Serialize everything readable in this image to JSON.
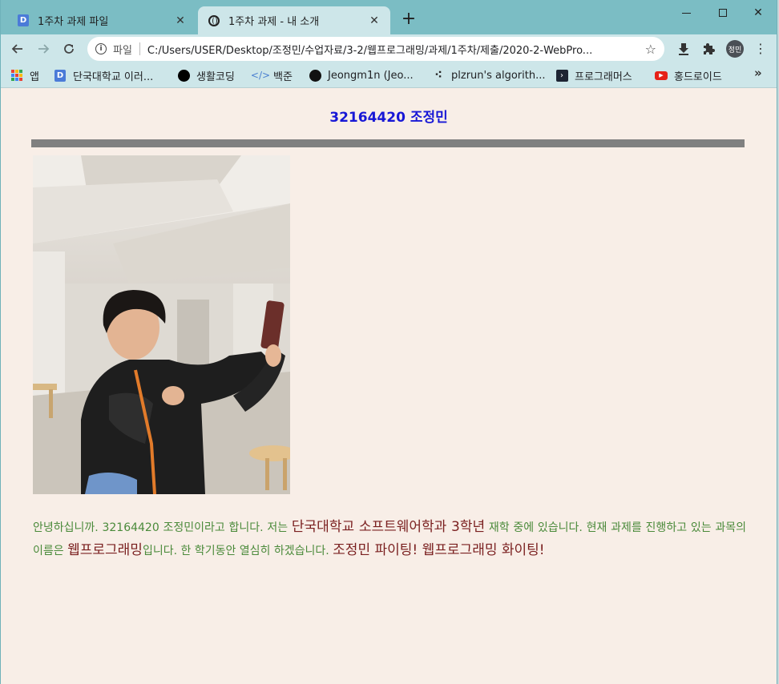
{
  "browser": {
    "tabs": [
      {
        "label": "1주차 과제 파일",
        "favicon": "docs-icon",
        "active": false
      },
      {
        "label": "1주차 과제 - 내 소개",
        "favicon": "globe-icon",
        "active": true
      }
    ],
    "new_tab_label": "+",
    "toolbar": {
      "scheme_label": "파일",
      "url": "C:/Users/USER/Desktop/조정민/수업자료/3-2/웹프로그래밍/과제/1주차/제출/2020-2-WebPro...",
      "avatar_label": "정민"
    },
    "bookmarks": [
      {
        "label": "앱",
        "icon": "apps-grid-icon"
      },
      {
        "label": "단국대학교 이러...",
        "icon": "docs-icon"
      },
      {
        "label": "생활코딩",
        "icon": "black-dot-icon"
      },
      {
        "label": "백준",
        "icon": "code-icon"
      },
      {
        "label": "Jeongm1n (Jeo...",
        "icon": "github-icon"
      },
      {
        "label": "plzrun's algorith...",
        "icon": "plzrun-icon"
      },
      {
        "label": "프로그래머스",
        "icon": "programmers-icon"
      },
      {
        "label": "홍드로이드",
        "icon": "youtube-icon"
      }
    ],
    "bookmarks_more": "»",
    "colors": {
      "titlebar": "#7bbdc4",
      "toolbar": "#cde6e9",
      "page_bg": "#f8eee7"
    }
  },
  "page": {
    "title": "32164420 조정민",
    "title_color": "#1717d6",
    "photo": "selfie-photo",
    "intro": {
      "p1": "안녕하십니까. 32164420 조정민이라고 합니다. 저는 ",
      "school": "단국대학교 소프트웨어학과 ",
      "grade_num": "3",
      "grade_word": "학년",
      "p2": " 재학 중에 있습니다. 현재 과제를 진행하고 있는 과목의 이름은 ",
      "course": "웹프로그래밍",
      "p3": "입니다. 한 학기동안 열심히 하겠습니다. ",
      "cheer": "조정민 파이팅! 웹프로그래밍 화이팅!"
    }
  }
}
